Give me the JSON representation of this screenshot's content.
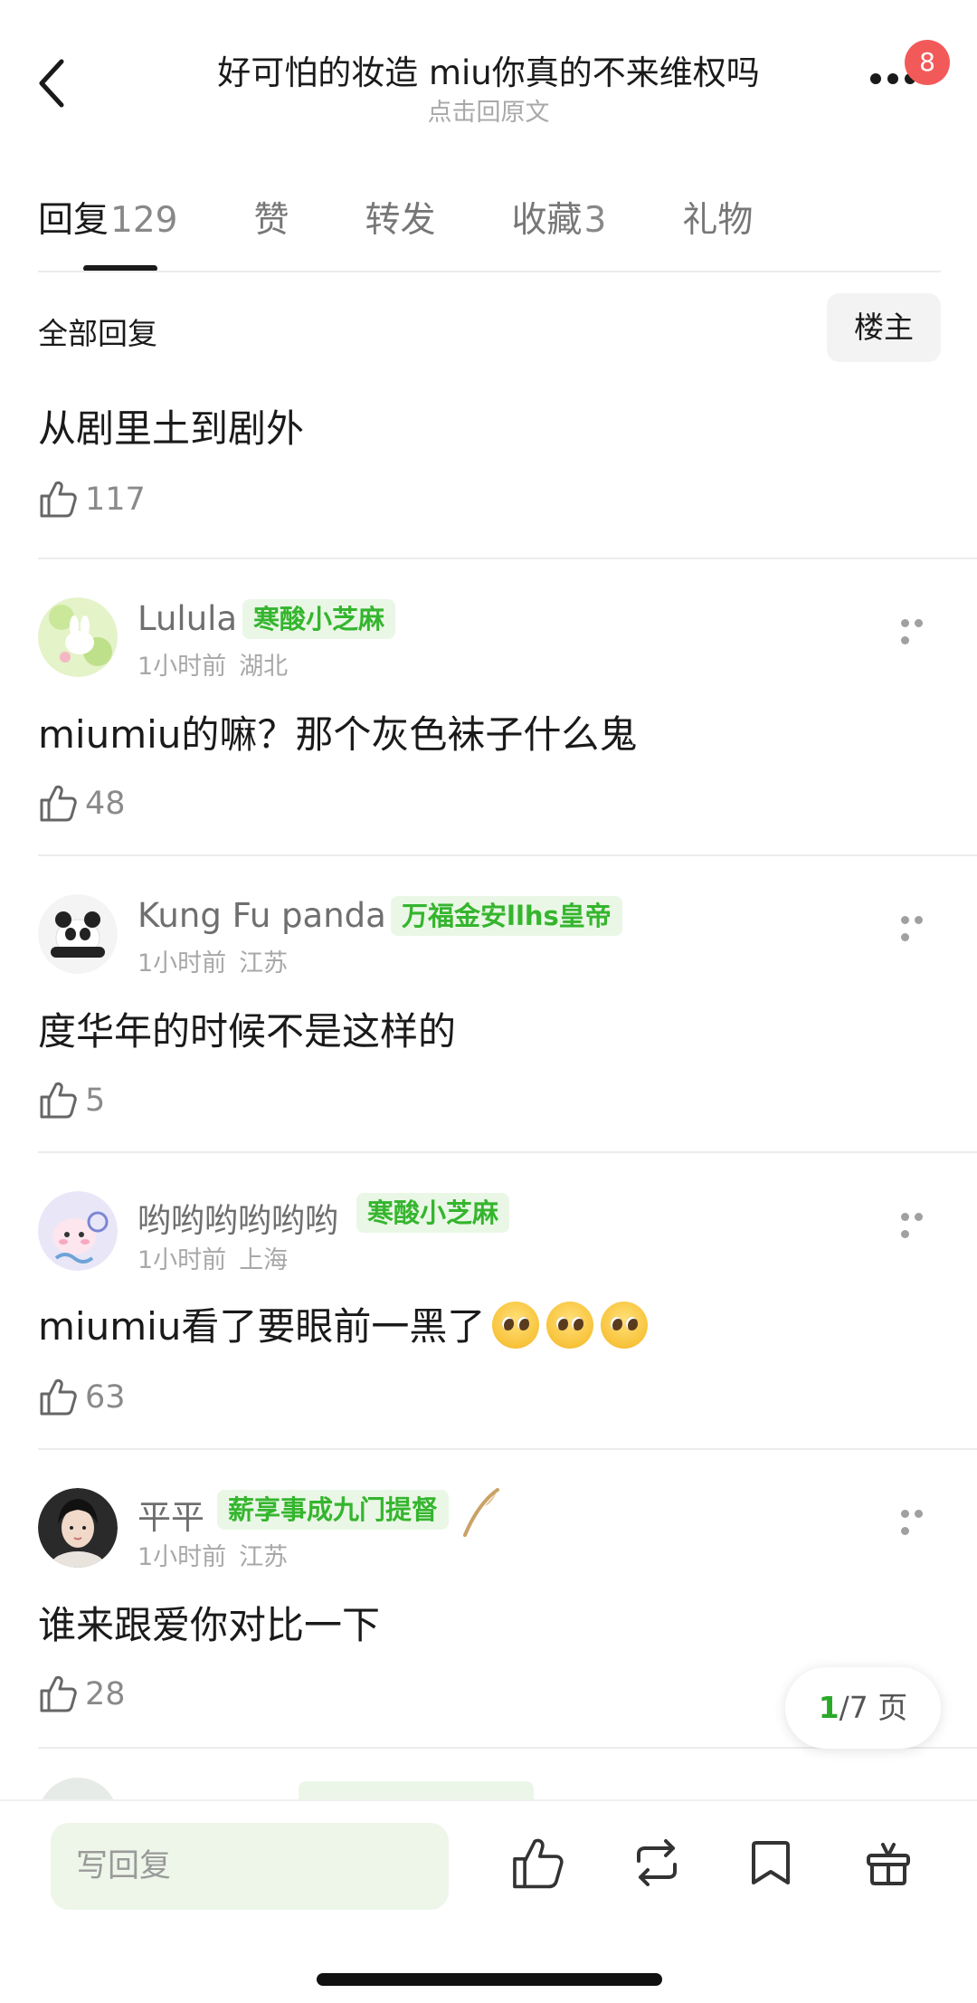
{
  "header": {
    "title": "好可怕的妆造 miu你真的不来维权吗",
    "subtitle": "点击回原文",
    "notification_count": "8"
  },
  "tabs": [
    {
      "label": "回复",
      "count": "129",
      "active": true
    },
    {
      "label": "赞",
      "count": "",
      "active": false
    },
    {
      "label": "转发",
      "count": "",
      "active": false
    },
    {
      "label": "收藏",
      "count": "3",
      "active": false
    },
    {
      "label": "礼物",
      "count": "",
      "active": false
    }
  ],
  "section": {
    "title": "全部回复",
    "filter_button": "楼主"
  },
  "top_reply": {
    "text": "从剧里土到剧外",
    "likes": "117"
  },
  "comments": [
    {
      "name": "Lulula",
      "tag": "寒酸小芝麻",
      "time": "1小时前",
      "location": "湖北",
      "text": "miumiu的嘛？那个灰色袜子什么鬼",
      "likes": "48"
    },
    {
      "name": "Kung Fu panda",
      "tag": "万福金安llhs皇帝",
      "time": "1小时前",
      "location": "江苏",
      "text": "度华年的时候不是这样的",
      "likes": "5"
    },
    {
      "name": "哟哟哟哟哟哟",
      "tag": "寒酸小芝麻",
      "time": "1小时前",
      "location": "上海",
      "text": "miumiu看了要眼前一黑了",
      "likes": "63"
    },
    {
      "name": "平平",
      "tag": "薪享事成九门提督",
      "time": "1小时前",
      "location": "江苏",
      "text": "谁来跟爱你对比一下",
      "likes": "28"
    }
  ],
  "pagination": {
    "current": "1",
    "total_text": "/7 页"
  },
  "bottom_bar": {
    "reply_placeholder": "写回复"
  },
  "colors": {
    "tag_green": "#35b52e",
    "tag_bg": "#eaf7e6",
    "badge_red": "#f25a5a",
    "input_bg": "#eef6ea"
  }
}
